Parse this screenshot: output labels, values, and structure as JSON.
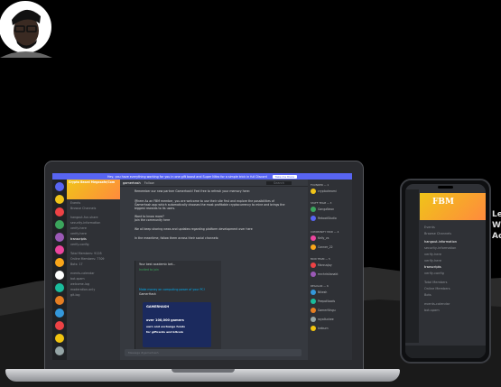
{
  "banner": {
    "text": "Hey, you have everything working for you in one gift boost and Super Nitro for a simple trick in full Discord",
    "button": "Take me there"
  },
  "server": {
    "name": "Crypto Beard Megasafe/Com"
  },
  "channels": [
    "Events",
    "Browse Channels",
    "hangout-fun-share",
    "security-information",
    "verify-here",
    "verify-here",
    "transcripts",
    "verify-config",
    "Total Members: 9128",
    "Online Members: 7709",
    "Bots: 17",
    "events-calendar",
    "bot-spam",
    "welcome-log",
    "moderation-only",
    "git-log"
  ],
  "chat": {
    "channel": "gamerhash",
    "channel_tag": "Follow",
    "search_placeholder": "Search",
    "messages": [
      "Remember our new partner Gamerhash! Feel free to refresh your memory here:",
      "@here As an FBM member, you are welcome to use their site first and explore the possibilities of",
      "Gamerhash app which automatically chooses the most profitable cryptocurrency to mine and brings the",
      "biggest rewards to its users.",
      "Want to know more?",
      "Join the community here",
      "We all keep sharing news and updates regarding platform development over here",
      "In the meantime, follow them across their social channels:"
    ],
    "embed": {
      "title": "Your best academic bet...",
      "sub": "Invited to join",
      "link": "Make money on computing power of your PC!",
      "source": "GamerHash",
      "promo_head": "GAMERHASH",
      "promo_line1": "over 100,000 gamers",
      "promo_line2": "earn and exchange funds",
      "promo_line3": "for giftcards and bitcoin"
    },
    "input_placeholder": "Message #gamerhash"
  },
  "members": {
    "groups": [
      {
        "label": "FOUNDER — 1",
        "names": [
          "cryptodreami"
        ]
      },
      {
        "label": "STAFF TEAM — 3",
        "names": [
          "GangaNeon",
          "RebootStudio"
        ]
      },
      {
        "label": "COMMUNITY MOD — 4",
        "names": [
          "Kelly_vs",
          "Conner_22"
        ]
      },
      {
        "label": "MOD TEAM — 5",
        "names": [
          "MarcusJay",
          "mrchristianakt"
        ]
      },
      {
        "label": "REGULAR — 6",
        "names": [
          "Nikesh",
          "PeepoNoods",
          "GamerNingu",
          "royalluckee",
          "Iceburn"
        ]
      }
    ]
  },
  "phone": {
    "banner_text": "FBM",
    "items": [
      "Events",
      "Browse Channels",
      "hangout-information",
      "security-information",
      "verify-here",
      "verify-here",
      "transcripts",
      "verify-config",
      "Total Members",
      "Online Members",
      "Bots",
      "events-calendar",
      "bot-spam"
    ]
  },
  "side_text": [
    "Le",
    "Wo",
    "Ac"
  ],
  "colors": {
    "blurple": "#5865f2",
    "bg_dark": "#202225",
    "bg_mid": "#2f3136",
    "bg_chat": "#36393f",
    "banner_gold": "#f0c419"
  }
}
